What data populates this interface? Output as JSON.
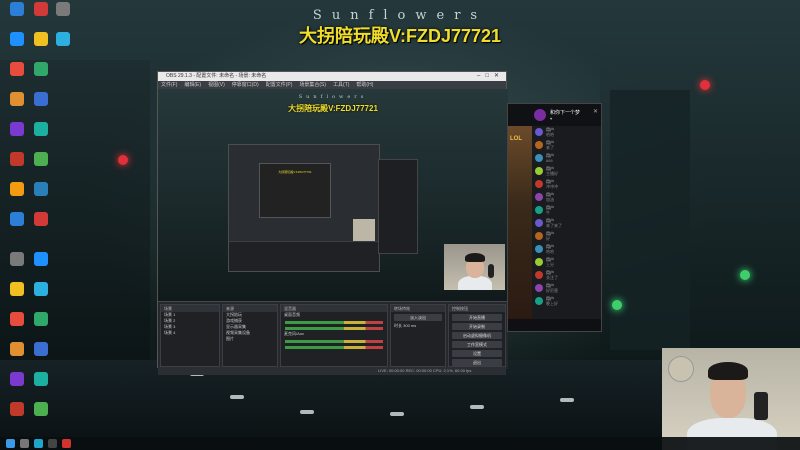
{
  "wallpaper": {
    "title": "Sunflowers",
    "banner": "大拐陪玩殿V:FZDJ77721"
  },
  "desktop_icons": [
    {
      "label": "",
      "color": "#2b7fd6"
    },
    {
      "label": "",
      "color": "#d23a3a"
    },
    {
      "label": "",
      "color": "#7a7a7a"
    },
    {
      "label": "",
      "color": "#1e90ff"
    },
    {
      "label": "",
      "color": "#f0c020"
    },
    {
      "label": "",
      "color": "#2bb0e0"
    },
    {
      "label": "",
      "color": "#e74c3c"
    },
    {
      "label": "",
      "color": "#2fa86a"
    },
    {
      "label": "",
      "color": "#e09030"
    },
    {
      "label": "",
      "color": "#3a6ed0"
    },
    {
      "label": "",
      "color": "#7a3ad0"
    },
    {
      "label": "",
      "color": "#1cb0a0"
    },
    {
      "label": "",
      "color": "#c0392b"
    },
    {
      "label": "",
      "color": "#4caf50"
    },
    {
      "label": "",
      "color": "#f39c12"
    },
    {
      "label": "",
      "color": "#2980b9"
    }
  ],
  "obs": {
    "window_title": "OBS 29.1.3 - 配置文件: 未命名 - 场景: 未命名",
    "menu": [
      "文件(F)",
      "编辑(E)",
      "视图(V)",
      "停靠窗口(D)",
      "配置文件(P)",
      "场景集合(S)",
      "工具(T)",
      "帮助(H)"
    ],
    "preview": {
      "title": "Sunflowers",
      "banner": "大拐陪玩殿V:FZDJ77721"
    },
    "docks": {
      "scenes_header": "场景",
      "scenes": [
        "场景 1",
        "场景 2",
        "场景 3",
        "场景 4"
      ],
      "sources_header": "来源",
      "sources": [
        "大拐陪玩",
        "游戏捕获",
        "显示器采集",
        "视频采集设备",
        "图片"
      ],
      "mixer_header": "混音器",
      "mixer": [
        "桌面音频",
        "麦克风/Aux"
      ],
      "transitions_header": "转场特效",
      "transition_value": "淡入淡出",
      "duration_label": "时长",
      "duration_value": "300 ms",
      "controls_header": "控制按钮",
      "controls": [
        "开始直播",
        "开始录制",
        "启动虚拟摄像机",
        "工作室模式",
        "设置",
        "退出"
      ]
    },
    "status": "LIVE: 00:00:00  REC: 00:00:00  CPU: 2.1%, 60.00 fps"
  },
  "chat": {
    "streamer_name": "和你下一个梦",
    "streamer_sub": "♥",
    "game_label": "LOL",
    "messages": [
      {
        "name": "用户",
        "msg": "哈哈"
      },
      {
        "name": "用户",
        "msg": "来了"
      },
      {
        "name": "用户",
        "msg": "666"
      },
      {
        "name": "用户",
        "msg": "主播好"
      },
      {
        "name": "用户",
        "msg": "冲冲冲"
      },
      {
        "name": "用户",
        "msg": "加油"
      },
      {
        "name": "用户",
        "msg": "牛"
      },
      {
        "name": "用户",
        "msg": "来了来了"
      },
      {
        "name": "用户",
        "msg": "好"
      },
      {
        "name": "用户",
        "msg": "哈哈"
      },
      {
        "name": "用户",
        "msg": "上分"
      },
      {
        "name": "用户",
        "msg": "关注了"
      },
      {
        "name": "用户",
        "msg": "好厉害"
      },
      {
        "name": "用户",
        "msg": "晚上好"
      }
    ]
  },
  "taskbar": {
    "icons": [
      {
        "name": "start",
        "color": "#3a9ae8"
      },
      {
        "name": "search",
        "color": "#777777"
      },
      {
        "name": "edge",
        "color": "#1ea5c9"
      },
      {
        "name": "obs",
        "color": "#444444"
      },
      {
        "name": "app-red",
        "color": "#d0342c"
      }
    ]
  }
}
